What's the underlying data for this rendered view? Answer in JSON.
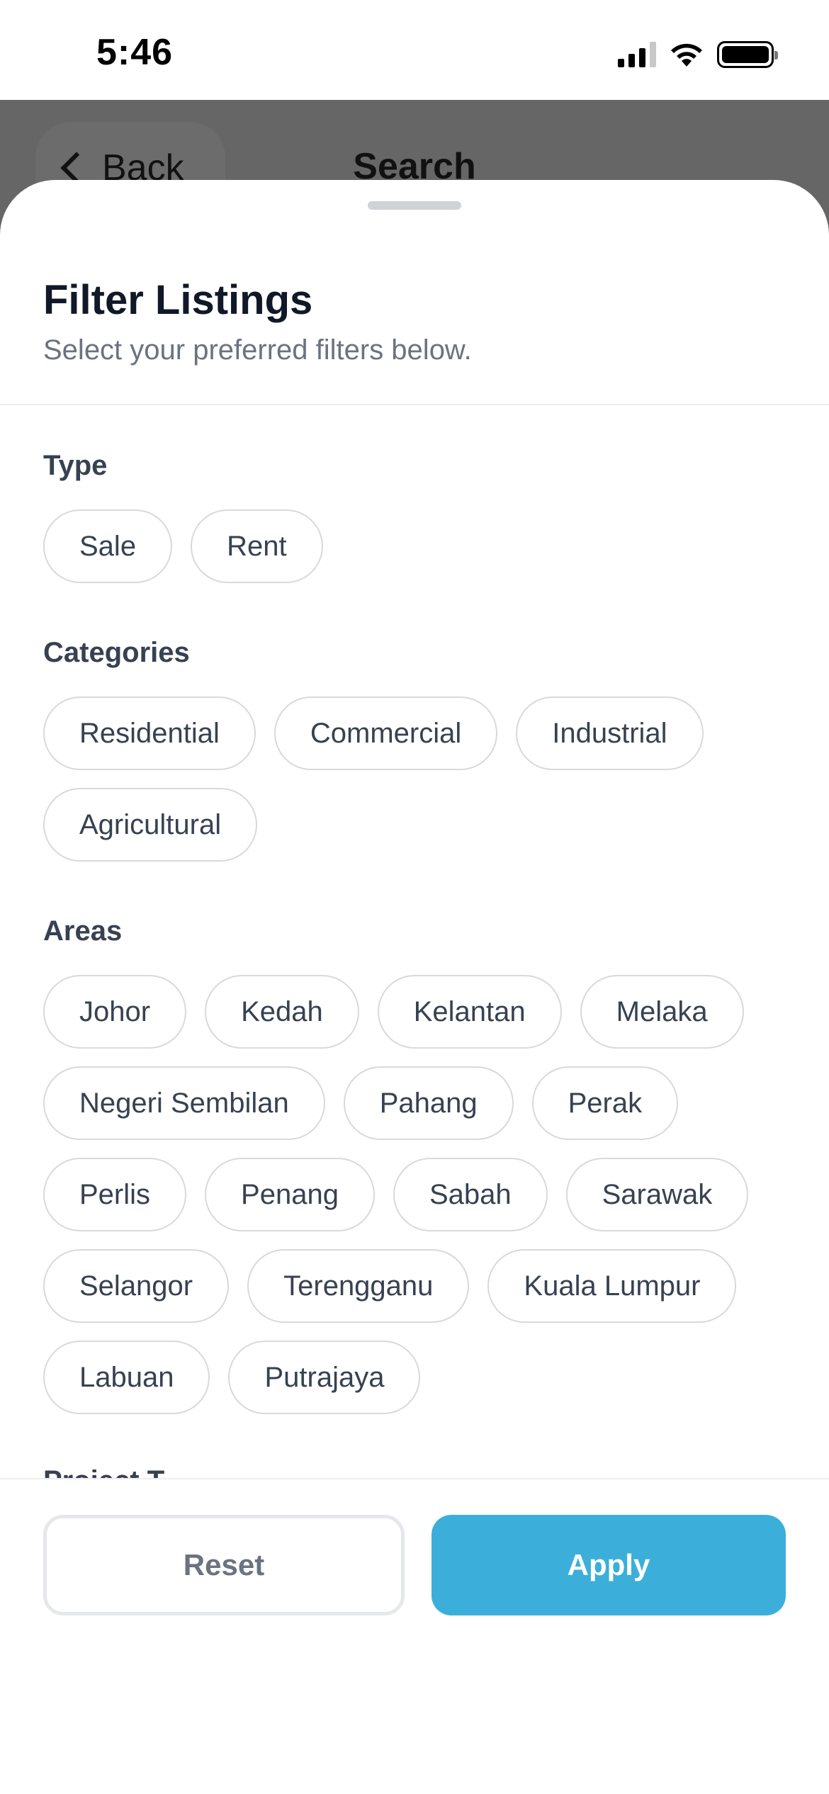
{
  "status_bar": {
    "time": "5:46",
    "icons": [
      "signal-icon",
      "wifi-icon",
      "battery-icon"
    ]
  },
  "nav": {
    "back_label": "Back",
    "title": "Search"
  },
  "sheet": {
    "title": "Filter Listings",
    "subtitle": "Select your preferred filters below.",
    "sections": {
      "type": {
        "label": "Type",
        "options": [
          "Sale",
          "Rent"
        ]
      },
      "categories": {
        "label": "Categories",
        "options": [
          "Residential",
          "Commercial",
          "Industrial",
          "Agricultural"
        ]
      },
      "areas": {
        "label": "Areas",
        "options": [
          "Johor",
          "Kedah",
          "Kelantan",
          "Melaka",
          "Negeri Sembilan",
          "Pahang",
          "Perak",
          "Perlis",
          "Penang",
          "Sabah",
          "Sarawak",
          "Selangor",
          "Terengganu",
          "Kuala Lumpur",
          "Labuan",
          "Putrajaya"
        ]
      },
      "next_section_partial": "Project T..."
    }
  },
  "footer": {
    "reset_label": "Reset",
    "apply_label": "Apply"
  },
  "colors": {
    "accent": "#3bafd9",
    "backdrop": "#666666",
    "chip_border": "#d7d9dd"
  }
}
